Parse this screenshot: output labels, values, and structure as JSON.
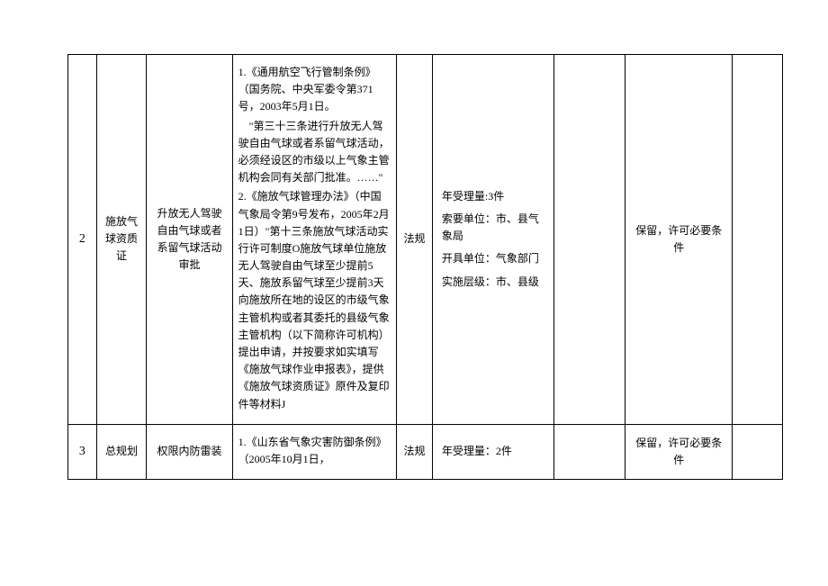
{
  "rows": [
    {
      "num": "2",
      "cert": "施放气球资质证",
      "name": "升放无人驾驶自由气球或者系留气球活动审批",
      "basis_p1": "1.《通用航空飞行管制条例》（国务院、中央军委令第371号，2003年5月1日。",
      "basis_p2": "　\"第三十三条进行升放无人驾驶自由气球或者系留气球活动，必须经设区的市级以上气象主管机构会同有关部门批准。……\"",
      "basis_p3": "2.《施放气球管理办法》（中国气象局令第9号发布，2005年2月1日）\"第十三条施放气球活动实行许可制度O施放气球单位施放无人驾驶自由气球至少提前5天、施放系留气球至少提前3天向施放所在地的设区的市级气象主管机构或者其委托的县级气象主管机构（以下简称许可机构）提出申请，并按要求如实填写《施放气球作业申报表》，提供《施放气球资质证》原件及复印件等材料J",
      "type": "法规",
      "info_p1": "年受理量:3件",
      "info_p2": "索要单位：市、县气象局",
      "info_p3": "开具单位：气象部门",
      "info_p4": "实施层级：市、县级",
      "result": "保留，许可必要条件"
    },
    {
      "num": "3",
      "cert": "总规划",
      "name": "权限内防雷装",
      "basis_p1": "1.《山东省气象灾害防御条例》（2005年10月1日，",
      "type": "法规",
      "info_p1": "年受理量：2件",
      "result": "保留，许可必要条件"
    }
  ]
}
